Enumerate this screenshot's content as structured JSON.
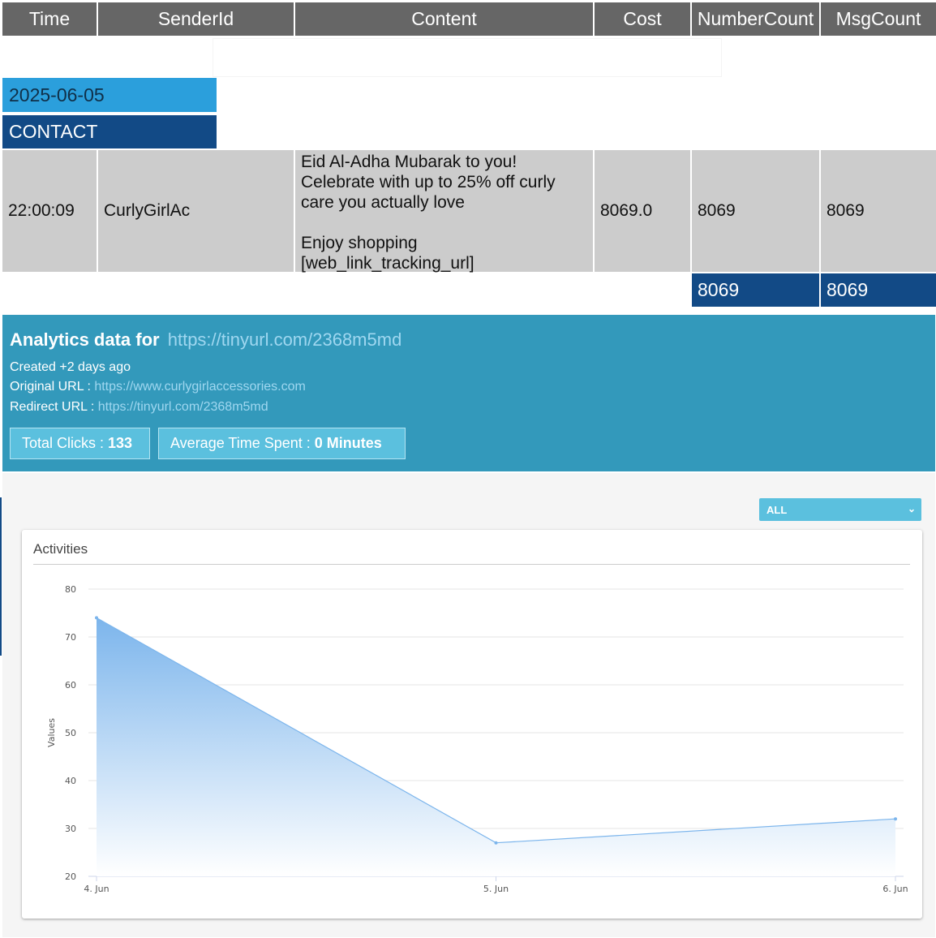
{
  "table": {
    "headers": [
      "Time",
      "SenderId",
      "Content",
      "Cost",
      "NumberCount",
      "MsgCount"
    ],
    "date": "2025-06-05",
    "category": "CONTACT",
    "rows": [
      {
        "time": "22:00:09",
        "sender": "CurlyGirlAc",
        "content": "Eid Al-Adha Mubarak to you!\nCelebrate with up to 25% off curly\ncare you actually love\n\nEnjoy shopping\n[web_link_tracking_url]",
        "cost": "8069.0",
        "number_count": "8069",
        "msg_count": "8069"
      }
    ],
    "totals": {
      "number_count": "8069",
      "msg_count": "8069"
    }
  },
  "analytics": {
    "title_prefix": "Analytics data for",
    "short_url": "https://tinyurl.com/2368m5md",
    "created": "Created +2 days ago",
    "original_label": "Original URL : ",
    "original_url": "https://www.curlygirlaccessories.com",
    "redirect_label": "Redirect URL : ",
    "redirect_url": "https://tinyurl.com/2368m5md",
    "clicks_label": "Total Clicks : ",
    "clicks_value": "133",
    "time_label": "Average Time Spent : ",
    "time_value": "0 Minutes"
  },
  "filter": {
    "selected": "ALL"
  },
  "chart_title": "Activities",
  "chart_data": {
    "type": "area",
    "title": "Activities",
    "xlabel": "",
    "ylabel": "Values",
    "categories": [
      "4. Jun",
      "5. Jun",
      "6. Jun"
    ],
    "values": [
      74,
      27,
      32
    ],
    "ylim": [
      20,
      80
    ],
    "yticks": [
      20,
      30,
      40,
      50,
      60,
      70,
      80
    ],
    "grid": true,
    "colors": {
      "line": "#7cb5ec",
      "fill_top": "#7cb5ec",
      "fill_bottom": "#ffffff"
    }
  }
}
